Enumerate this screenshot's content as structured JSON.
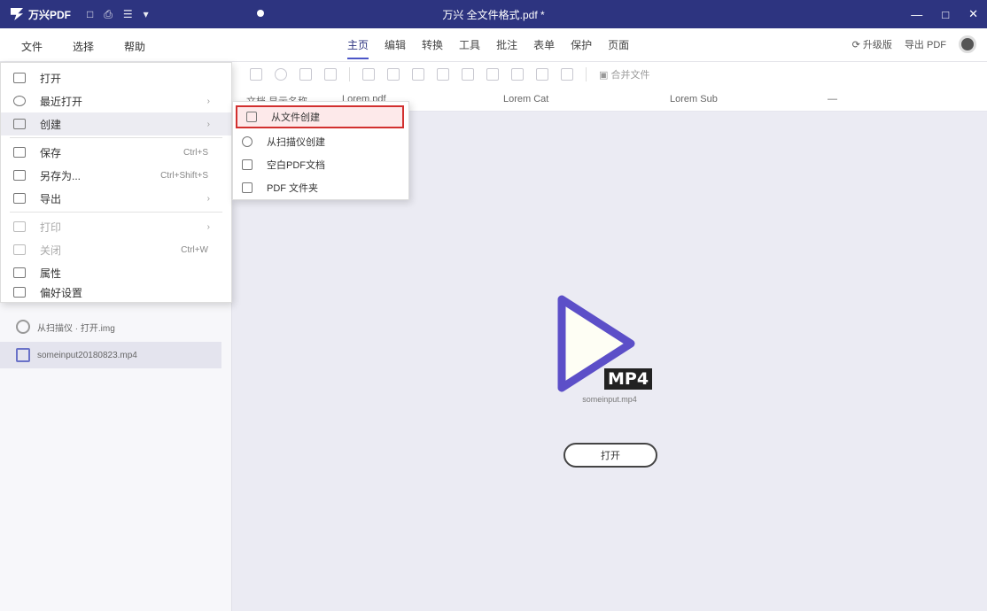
{
  "titlebar": {
    "app_name": "万兴PDF",
    "doc_title": "万兴 全文件格式.pdf *",
    "quick_access": [
      "□",
      "⎙",
      "☰",
      "▾"
    ],
    "window_controls": [
      "—",
      "□",
      "✕"
    ]
  },
  "menubar": {
    "left_menus": [
      "文件",
      "选择",
      "帮助"
    ],
    "ribbon_tabs": [
      "主页",
      "编辑",
      "转换",
      "工具",
      "批注",
      "表单",
      "保护",
      "页面"
    ],
    "active_tab_index": 0,
    "right_tools": [
      "⟳ 升级版",
      "导出 PDF"
    ]
  },
  "toolbar": {
    "right_text": "▣ 合并文件"
  },
  "docrow": {
    "name_label": "文档 显示名称",
    "name_value": "Lorem.pdf",
    "col1": "Lorem Cat",
    "col2": "Lorem Sub",
    "col3": "—"
  },
  "file_menu": {
    "items": [
      {
        "label": "打开",
        "shortcut": "",
        "arrow": false,
        "disabled": false
      },
      {
        "label": "最近打开",
        "shortcut": "",
        "arrow": true,
        "disabled": false
      },
      {
        "label": "创建",
        "shortcut": "",
        "arrow": true,
        "disabled": false,
        "hover": true
      },
      {
        "label": "保存",
        "shortcut": "Ctrl+S",
        "arrow": false,
        "disabled": false
      },
      {
        "label": "另存为...",
        "shortcut": "Ctrl+Shift+S",
        "arrow": false,
        "disabled": false
      },
      {
        "label": "导出",
        "shortcut": "",
        "arrow": true,
        "disabled": false
      },
      {
        "label": "打印",
        "shortcut": "",
        "arrow": true,
        "disabled": true
      },
      {
        "label": "关闭",
        "shortcut": "Ctrl+W",
        "arrow": false,
        "disabled": true
      },
      {
        "label": "属性",
        "shortcut": "",
        "arrow": false,
        "disabled": false
      },
      {
        "label": "偏好设置",
        "shortcut": "",
        "arrow": false,
        "disabled": false
      }
    ]
  },
  "submenu": {
    "items": [
      {
        "label": "从文件创建",
        "highlight": true
      },
      {
        "label": "从扫描仪创建",
        "highlight": false
      },
      {
        "label": "空白PDF文档",
        "highlight": false
      },
      {
        "label": "PDF 文件夹",
        "highlight": false
      }
    ]
  },
  "recent": {
    "items": [
      {
        "label": "从扫描仪 · 打开.img",
        "selected": false
      },
      {
        "label": "someinput20180823.mp4",
        "selected": true
      }
    ]
  },
  "center": {
    "badge": "MP4",
    "file_name": "someinput.mp4",
    "open_button": "打开"
  },
  "colors": {
    "titlebar": "#2d3480",
    "accent": "#4c56c8",
    "highlight_border": "#d2302f",
    "workspace_bg": "#ebebf3"
  }
}
